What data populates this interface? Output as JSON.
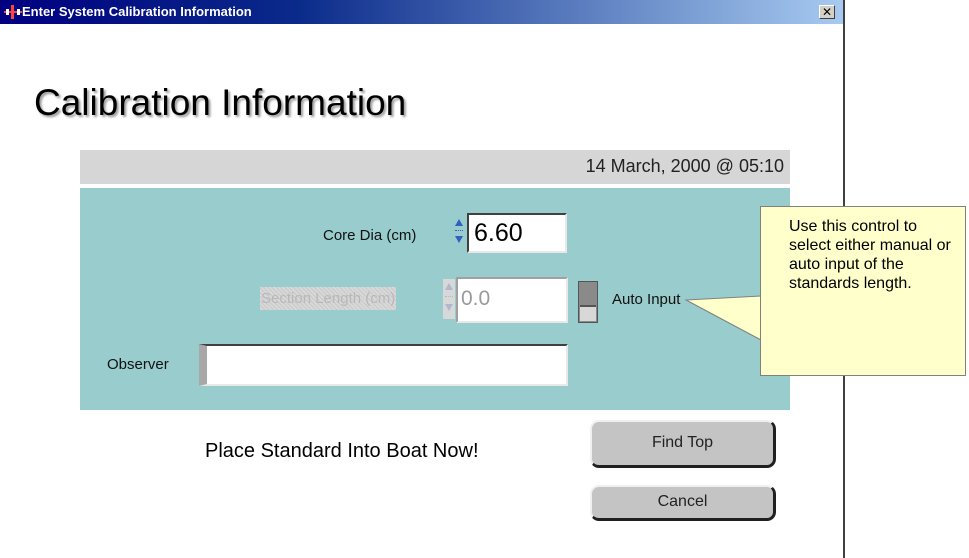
{
  "window": {
    "title": "Enter System Calibration Information",
    "close_glyph": "✕"
  },
  "heading": "Calibration Information",
  "date_line": "14 March, 2000  @ 05:10",
  "form": {
    "core_dia": {
      "label": "Core Dia (cm)",
      "value": "6.60"
    },
    "section_length": {
      "label": "Section Length (cm)",
      "value": "0.0",
      "enabled": false
    },
    "auto_input_label": "Auto Input",
    "observer": {
      "label": "Observer",
      "value": ""
    }
  },
  "message": "Place Standard Into Boat Now!",
  "buttons": {
    "find_top": "Find Top",
    "cancel": "Cancel"
  },
  "tooltip": "Use this control to select either manual or auto input of the standards length.",
  "colors": {
    "panel": "#99cccc",
    "date_bar": "#d6d6d6",
    "tooltip_bg": "#ffffcc",
    "titlebar": "#000080"
  },
  "icons": [
    "app-icon",
    "close-icon",
    "spin-up-icon",
    "spin-down-icon",
    "toggle-switch-icon"
  ]
}
